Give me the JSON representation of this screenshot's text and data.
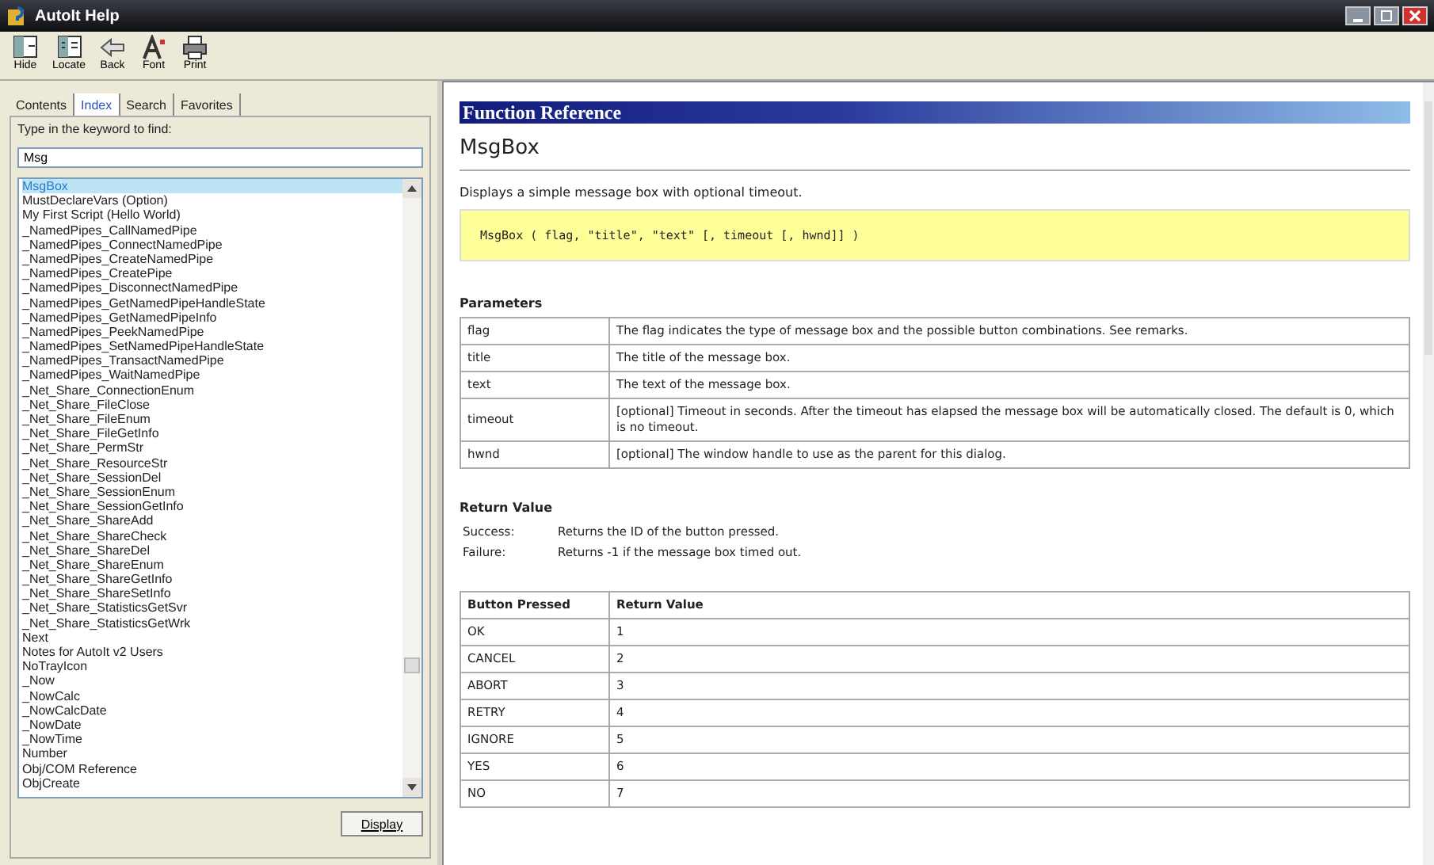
{
  "window": {
    "title": "AutoIt Help"
  },
  "toolbar": [
    {
      "label": "Hide",
      "kind": "hide"
    },
    {
      "label": "Locate",
      "kind": "locate"
    },
    {
      "label": "Back",
      "kind": "back"
    },
    {
      "label": "Font",
      "kind": "font"
    },
    {
      "label": "Print",
      "kind": "print"
    }
  ],
  "tabs": [
    {
      "label": "Contents",
      "selected": false
    },
    {
      "label": "Index",
      "selected": true
    },
    {
      "label": "Search",
      "selected": false
    },
    {
      "label": "Favorites",
      "selected": false
    }
  ],
  "keyword_label": "Type in the keyword to find:",
  "keyword_field": {
    "value": "Msg"
  },
  "index_list": [
    {
      "label": "MsgBox",
      "selected": true
    },
    {
      "label": "MustDeclareVars (Option)",
      "selected": false
    },
    {
      "label": "My First Script (Hello World)",
      "selected": false
    },
    {
      "label": "_NamedPipes_CallNamedPipe",
      "selected": false
    },
    {
      "label": "_NamedPipes_ConnectNamedPipe",
      "selected": false
    },
    {
      "label": "_NamedPipes_CreateNamedPipe",
      "selected": false
    },
    {
      "label": "_NamedPipes_CreatePipe",
      "selected": false
    },
    {
      "label": "_NamedPipes_DisconnectNamedPipe",
      "selected": false
    },
    {
      "label": "_NamedPipes_GetNamedPipeHandleState",
      "selected": false
    },
    {
      "label": "_NamedPipes_GetNamedPipeInfo",
      "selected": false
    },
    {
      "label": "_NamedPipes_PeekNamedPipe",
      "selected": false
    },
    {
      "label": "_NamedPipes_SetNamedPipeHandleState",
      "selected": false
    },
    {
      "label": "_NamedPipes_TransactNamedPipe",
      "selected": false
    },
    {
      "label": "_NamedPipes_WaitNamedPipe",
      "selected": false
    },
    {
      "label": "_Net_Share_ConnectionEnum",
      "selected": false
    },
    {
      "label": "_Net_Share_FileClose",
      "selected": false
    },
    {
      "label": "_Net_Share_FileEnum",
      "selected": false
    },
    {
      "label": "_Net_Share_FileGetInfo",
      "selected": false
    },
    {
      "label": "_Net_Share_PermStr",
      "selected": false
    },
    {
      "label": "_Net_Share_ResourceStr",
      "selected": false
    },
    {
      "label": "_Net_Share_SessionDel",
      "selected": false
    },
    {
      "label": "_Net_Share_SessionEnum",
      "selected": false
    },
    {
      "label": "_Net_Share_SessionGetInfo",
      "selected": false
    },
    {
      "label": "_Net_Share_ShareAdd",
      "selected": false
    },
    {
      "label": "_Net_Share_ShareCheck",
      "selected": false
    },
    {
      "label": "_Net_Share_ShareDel",
      "selected": false
    },
    {
      "label": "_Net_Share_ShareEnum",
      "selected": false
    },
    {
      "label": "_Net_Share_ShareGetInfo",
      "selected": false
    },
    {
      "label": "_Net_Share_ShareSetInfo",
      "selected": false
    },
    {
      "label": "_Net_Share_StatisticsGetSvr",
      "selected": false
    },
    {
      "label": "_Net_Share_StatisticsGetWrk",
      "selected": false
    },
    {
      "label": "Next",
      "selected": false
    },
    {
      "label": "Notes for AutoIt v2 Users",
      "selected": false
    },
    {
      "label": "NoTrayIcon",
      "selected": false
    },
    {
      "label": "_Now",
      "selected": false
    },
    {
      "label": "_NowCalc",
      "selected": false
    },
    {
      "label": "_NowCalcDate",
      "selected": false
    },
    {
      "label": "_NowDate",
      "selected": false
    },
    {
      "label": "_NowTime",
      "selected": false
    },
    {
      "label": "Number",
      "selected": false
    },
    {
      "label": "Obj/COM Reference",
      "selected": false
    },
    {
      "label": "ObjCreate",
      "selected": false
    }
  ],
  "display_button": "Display",
  "content": {
    "section_header": "Function Reference",
    "title": "MsgBox",
    "description": "Displays a simple message box with optional timeout.",
    "syntax": "MsgBox ( flag, \"title\", \"text\" [, timeout [, hwnd]] )",
    "parameters_heading": "Parameters",
    "parameters": [
      {
        "name": "flag",
        "description": "The flag indicates the type of message box and the possible button combinations. See remarks."
      },
      {
        "name": "title",
        "description": "The title of the message box."
      },
      {
        "name": "text",
        "description": "The text of the message box."
      },
      {
        "name": "timeout",
        "description": "[optional] Timeout in seconds. After the timeout has elapsed the message box will be automatically closed. The default is 0, which is no timeout."
      },
      {
        "name": "hwnd",
        "description": "[optional] The window handle to use as the parent for this dialog."
      }
    ],
    "return_heading": "Return Value",
    "returns": [
      {
        "label": "Success:",
        "text": "Returns the ID of the button pressed."
      },
      {
        "label": "Failure:",
        "text": "Returns -1 if the message box timed out."
      }
    ],
    "table": {
      "columns": [
        "Button Pressed",
        "Return Value"
      ],
      "rows": [
        [
          "OK",
          "1"
        ],
        [
          "CANCEL",
          "2"
        ],
        [
          "ABORT",
          "3"
        ],
        [
          "RETRY",
          "4"
        ],
        [
          "IGNORE",
          "5"
        ],
        [
          "YES",
          "6"
        ],
        [
          "NO",
          "7"
        ]
      ]
    }
  }
}
